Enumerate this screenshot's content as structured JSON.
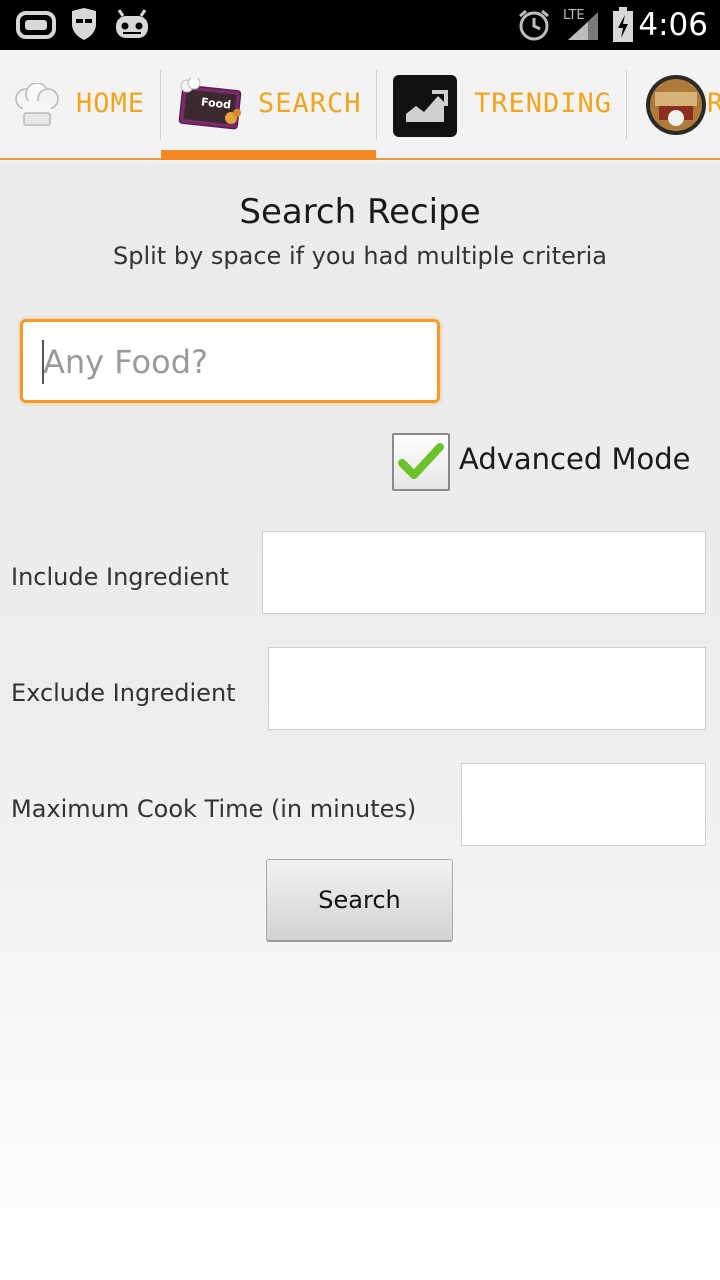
{
  "status_bar": {
    "time": "4:06",
    "network": "LTE",
    "icons": [
      "gamepad-icon",
      "incognito-icon",
      "cyanogen-android-icon",
      "alarm-icon",
      "signal-icon",
      "battery-charging-icon"
    ]
  },
  "tabs": [
    {
      "label": "HOME",
      "icon": "chef-hat-icon",
      "selected": false
    },
    {
      "label": "SEARCH",
      "icon": "food-chalkboard-icon",
      "icon_text": "Food",
      "selected": true
    },
    {
      "label": "TRENDING",
      "icon": "trending-chart-icon",
      "selected": false
    },
    {
      "label": "R",
      "icon": "restaurant-icon",
      "selected": false
    }
  ],
  "search": {
    "title": "Search Recipe",
    "subtitle": "Split by space if you had multiple criteria",
    "food_placeholder": "Any Food?",
    "advanced_mode_label": "Advanced Mode",
    "advanced_mode_checked": true,
    "include_label": "Include Ingredient",
    "include_value": "",
    "exclude_label": "Exclude Ingredient",
    "exclude_value": "",
    "max_cook_label": "Maximum Cook Time (in minutes)",
    "max_cook_value": "",
    "button_label": "Search"
  },
  "colors": {
    "accent": "#f5881f",
    "tab_text": "#f1a51f",
    "checkmark": "#6cc22a"
  }
}
